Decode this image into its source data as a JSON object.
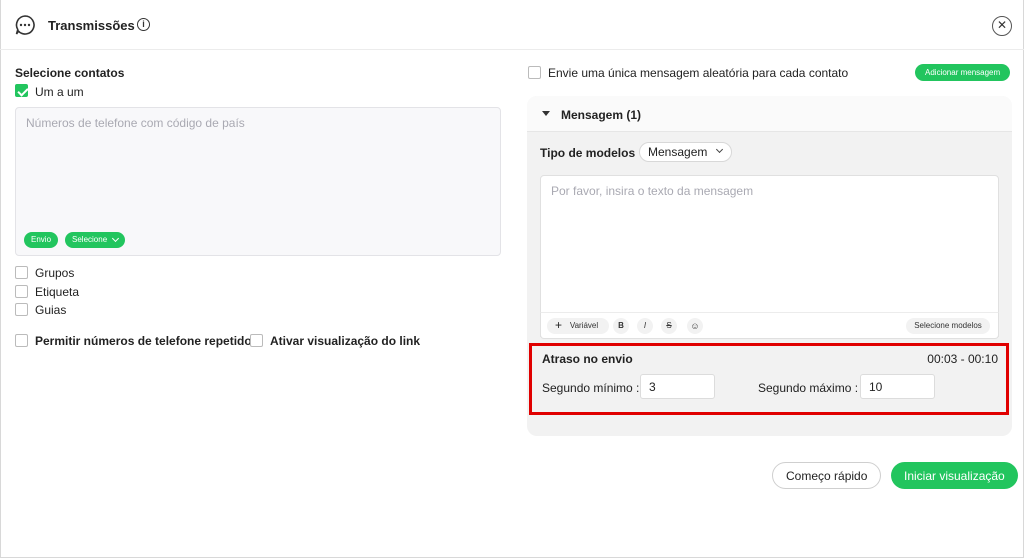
{
  "header": {
    "title": "Transmissões",
    "info_icon": "info-icon",
    "close_icon": "close-icon",
    "app_icon": "chat-bubble-icon"
  },
  "contacts": {
    "section_label": "Selecione contatos",
    "one_by_one": {
      "label": "Um a um",
      "checked": true
    },
    "phone_placeholder": "Números de telefone com código de país",
    "send_pill": "Envio",
    "select_pill": "Selecione",
    "groups": {
      "label": "Grupos",
      "checked": false
    },
    "tag": {
      "label": "Etiqueta",
      "checked": false
    },
    "tabs": {
      "label": "Guias",
      "checked": false
    },
    "allow_repeat": {
      "label": "Permitir números de telefone repetidos",
      "checked": false
    },
    "link_preview": {
      "label": "Ativar visualização do link",
      "checked": false
    }
  },
  "message": {
    "random_label": "Envie uma única mensagem aleatória para cada contato",
    "random_checked": false,
    "add_button": "Adicionar mensagem",
    "panel_title": "Mensagem (1)",
    "template_type_label": "Tipo de modelos",
    "template_type_value": "Mensagem",
    "text_placeholder": "Por favor, insira o texto da mensagem",
    "toolbar": {
      "variable": "Variável",
      "bold": "B",
      "italic": "I",
      "strike": "S",
      "emoji": "☺",
      "select_templates": "Selecione modelos"
    }
  },
  "delay": {
    "title": "Atraso no envio",
    "range": "00:03 - 00:10",
    "min_label": "Segundo mínimo :",
    "min_value": "3",
    "max_label": "Segundo máximo :",
    "max_value": "10"
  },
  "actions": {
    "quick_start": "Começo rápido",
    "start_preview": "Iniciar visualização"
  },
  "colors": {
    "accent": "#22c55e",
    "highlight": "#e00000"
  }
}
